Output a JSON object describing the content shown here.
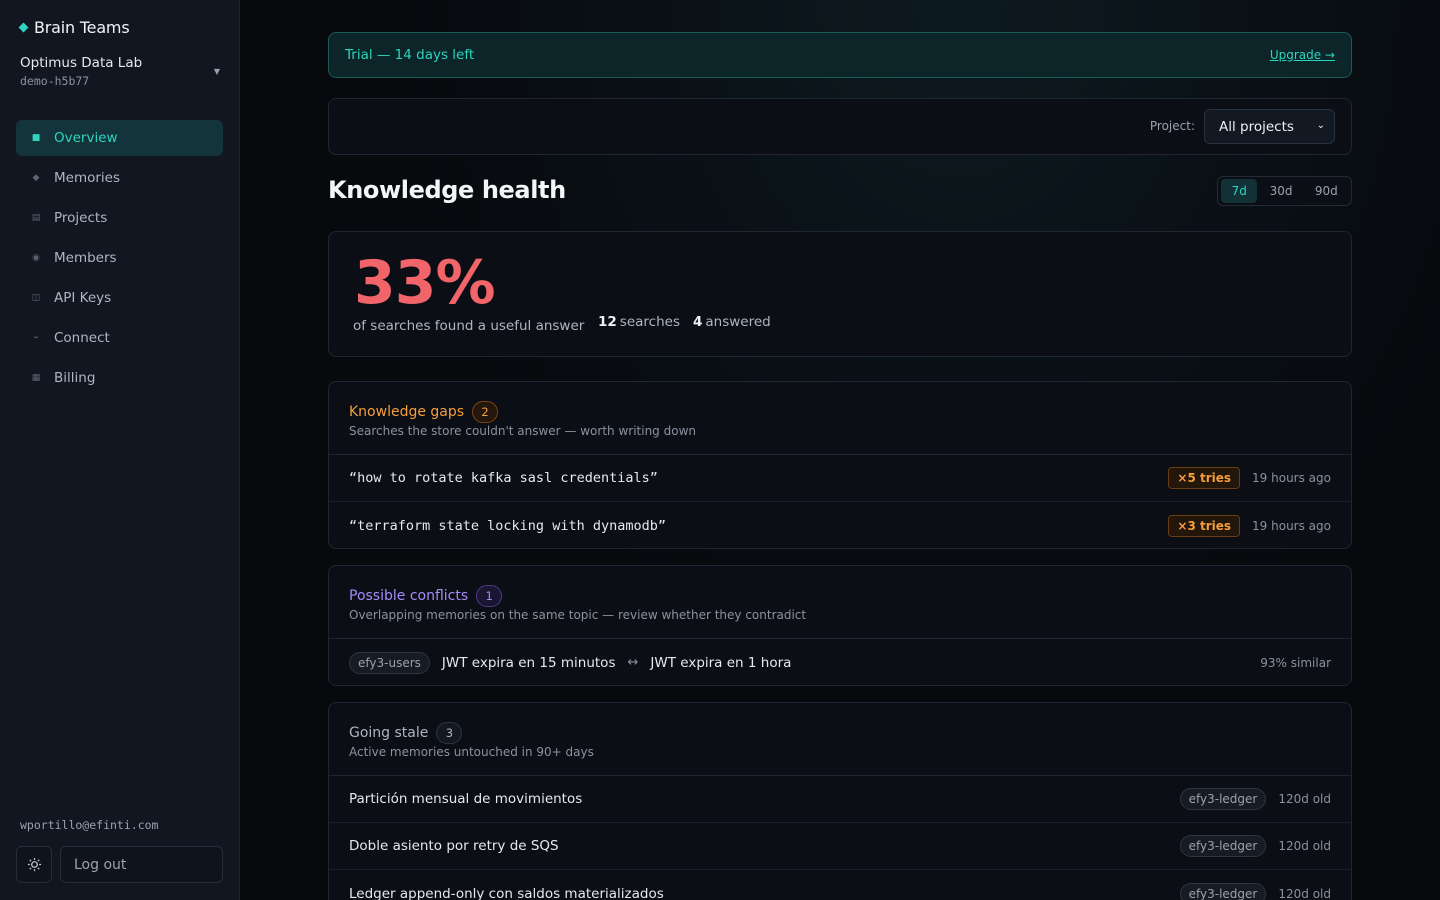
{
  "sidebar": {
    "brand": "Brain Teams",
    "org": {
      "name": "Optimus Data Lab",
      "id": "demo-h5b77"
    },
    "nav": [
      {
        "label": "Overview",
        "icon": "overview-icon",
        "glyph": "■"
      },
      {
        "label": "Memories",
        "icon": "memories-icon",
        "glyph": "◆"
      },
      {
        "label": "Projects",
        "icon": "projects-icon",
        "glyph": "▤"
      },
      {
        "label": "Members",
        "icon": "members-icon",
        "glyph": "◉"
      },
      {
        "label": "API Keys",
        "icon": "api-keys-icon",
        "glyph": "◫"
      },
      {
        "label": "Connect",
        "icon": "connect-icon",
        "glyph": "⌁"
      },
      {
        "label": "Billing",
        "icon": "billing-icon",
        "glyph": "▦"
      }
    ],
    "active_nav": "Overview",
    "user_email": "wportillo@efinti.com",
    "logout_label": "Log out"
  },
  "trial": {
    "text": "Trial — 14 days left",
    "link": "Upgrade →"
  },
  "filter": {
    "label": "Project:",
    "value": "All projects"
  },
  "page_title": "Knowledge health",
  "range": {
    "options": [
      "7d",
      "30d",
      "90d"
    ],
    "selected": "7d"
  },
  "health": {
    "percent": "33%",
    "caption": "of searches found a useful answer",
    "searches_count": "12",
    "searches_label": "searches",
    "answered_count": "4",
    "answered_label": "answered"
  },
  "gaps": {
    "title": "Knowledge gaps",
    "count": "2",
    "subtitle": "Searches the store couldn't answer — worth writing down",
    "rows": [
      {
        "query": "“how to rotate kafka sasl credentials”",
        "tries": "×5 tries",
        "ago": "19 hours ago"
      },
      {
        "query": "“terraform state locking with dynamodb”",
        "tries": "×3 tries",
        "ago": "19 hours ago"
      }
    ]
  },
  "conflicts": {
    "title": "Possible conflicts",
    "count": "1",
    "subtitle": "Overlapping memories on the same topic — review whether they contradict",
    "rows": [
      {
        "tag": "efy3-users",
        "a": "JWT expira en 15 minutos",
        "arrow": "↔",
        "b": "JWT expira en 1 hora",
        "similarity": "93% similar"
      }
    ]
  },
  "stale": {
    "title": "Going stale",
    "count": "3",
    "subtitle": "Active memories untouched in 90+ days",
    "rows": [
      {
        "title": "Partición mensual de movimientos",
        "tag": "efy3-ledger",
        "age": "120d old"
      },
      {
        "title": "Doble asiento por retry de SQS",
        "tag": "efy3-ledger",
        "age": "120d old"
      },
      {
        "title": "Ledger append-only con saldos materializados",
        "tag": "efy3-ledger",
        "age": "120d old"
      }
    ]
  },
  "colors": {
    "accent": "#2dd4bf",
    "danger": "#f0646a",
    "warning": "#f59e3b",
    "conflict": "#a78bfa"
  }
}
